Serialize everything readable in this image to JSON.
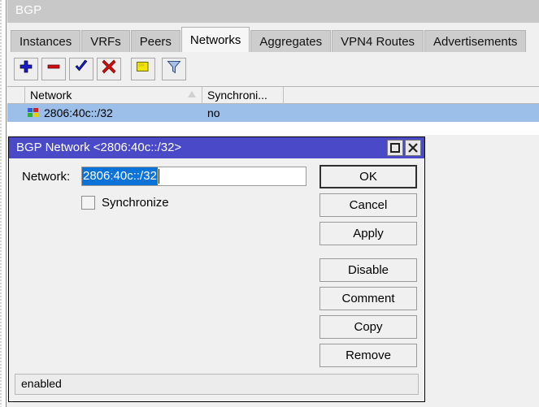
{
  "window": {
    "title": "BGP",
    "tabs": [
      {
        "label": "Instances",
        "active": false
      },
      {
        "label": "VRFs",
        "active": false
      },
      {
        "label": "Peers",
        "active": false
      },
      {
        "label": "Networks",
        "active": true
      },
      {
        "label": "Aggregates",
        "active": false
      },
      {
        "label": "VPN4 Routes",
        "active": false
      },
      {
        "label": "Advertisements",
        "active": false
      }
    ]
  },
  "toolbar": {
    "buttons": [
      {
        "name": "add-button",
        "icon": "plus-icon",
        "color": "#1a1ad0"
      },
      {
        "name": "remove-button",
        "icon": "minus-icon",
        "color": "#d01010"
      },
      {
        "name": "enable-button",
        "icon": "check-icon",
        "color": "#1a1ad0"
      },
      {
        "name": "disable-button",
        "icon": "cross-icon",
        "color": "#d01010"
      },
      {
        "name": "comment-button",
        "icon": "note-icon",
        "color": "#f2e400"
      },
      {
        "name": "filter-button",
        "icon": "funnel-icon",
        "color": "#8fa8d8"
      }
    ]
  },
  "list": {
    "columns": [
      {
        "label": "Network",
        "sorted": "asc"
      },
      {
        "label": "Synchroni...",
        "sorted": ""
      },
      {
        "label": "",
        "sorted": ""
      }
    ],
    "rows": [
      {
        "network": "2806:40c::/32",
        "synchronize": "no",
        "selected": true
      }
    ]
  },
  "dialog": {
    "title": "BGP Network <2806:40c::/32>",
    "maximize_label": "maximize-icon",
    "close_label": "✕",
    "fields": {
      "network_label": "Network:",
      "network_value": "2806:40c::/32",
      "synchronize_label": "Synchronize",
      "synchronize_checked": false
    },
    "buttons": [
      {
        "label": "OK",
        "primary": true,
        "gap_after": false
      },
      {
        "label": "Cancel",
        "primary": false,
        "gap_after": false
      },
      {
        "label": "Apply",
        "primary": false,
        "gap_after": true
      },
      {
        "label": "Disable",
        "primary": false,
        "gap_after": false
      },
      {
        "label": "Comment",
        "primary": false,
        "gap_after": false
      },
      {
        "label": "Copy",
        "primary": false,
        "gap_after": false
      },
      {
        "label": "Remove",
        "primary": false,
        "gap_after": false
      }
    ],
    "status": "enabled"
  },
  "colors": {
    "title_bar": "#c8c8c8",
    "dialog_title_bar": "#4a49c8",
    "selection_row": "#9bbfe8",
    "text_selection": "#0b73d8",
    "face": "#f0f0f0"
  }
}
